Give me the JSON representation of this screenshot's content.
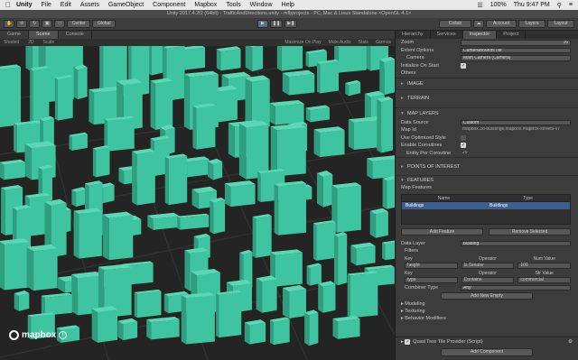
{
  "menubar": {
    "items": [
      "Unity",
      "File",
      "Edit",
      "Assets",
      "GameObject",
      "Component",
      "Mapbox",
      "Tools",
      "Window",
      "Help"
    ],
    "clock": "Thu 9:47 PM",
    "battery": "100%"
  },
  "window": {
    "title": "Unity 2017.4.2f2 (64bit) - TrafficAndDirections.unity - mfbprojects - PC, Mac & Linux Standalone <OpenGL 4.1>"
  },
  "toolbar": {
    "pivot": "Center",
    "space": "Global",
    "collab": "Collab",
    "account": "Account",
    "layers": "Layers",
    "layout": "Layout"
  },
  "scene": {
    "tabs": [
      "Game",
      "Scene",
      "Console"
    ],
    "shading": "Shaded",
    "mode": "2D",
    "scale_label": "Scale",
    "maximize": "Maximize On Play",
    "mute": "Mute Audio",
    "stats": "Stats",
    "gizmos": "Gizmos"
  },
  "logo": {
    "text": "mapbox",
    "info": "i"
  },
  "inspector": {
    "tabs": [
      "Hierarchy",
      "Services",
      "Inspector",
      "Project"
    ],
    "zoom_label": "Zoom",
    "zoom_value": "16",
    "extent_label": "Extent Options",
    "extent_value": "CameraBoundsTile",
    "camera_label": "Camera",
    "camera_value": "Main Camera (Camera)",
    "init_label": "Initialize On Start",
    "others": "Others",
    "image": "IMAGE",
    "terrain": "TERRAIN",
    "map_layers": "MAP LAYERS",
    "data_source_label": "Data Source",
    "data_source_value": "Custom",
    "map_id_label": "Map Id",
    "map_id_value": "mapbox.3d-buildings,mapbox.mapbox-streets-v7",
    "style_label": "Use Optimized Style",
    "coalesce_label": "Enable Coroutines",
    "entities_label": "Entity Per Coroutine",
    "entities_value": "25",
    "poi": "POINTS OF INTEREST",
    "features": "FEATURES",
    "map_features": "Map Features",
    "col_name": "Name",
    "col_type": "Type",
    "row_name": "Buildings",
    "row_type": "Buildings",
    "add_feature": "Add Feature",
    "remove_selected": "Remove Selected",
    "data_layer_label": "Data Layer",
    "data_layer_value": "building",
    "filters": "Filters",
    "key_label": "Key",
    "operator_label": "Operator",
    "num_value_label": "Num Value",
    "key1": "height",
    "op1": "Is Greater",
    "num1": "100",
    "key2": "type",
    "op2": "Contains",
    "str_value_label": "Str Value",
    "str1": "commercial",
    "combiner_label": "Combiner Type",
    "combiner_value": "Any",
    "add_empty": "Add New Empty",
    "modeling": "Modeling",
    "texturing": "Texturing",
    "behavior": "Behavior Modifiers",
    "provider": "Quad Tree Tile Provider (Script)",
    "add_component": "Add Component"
  },
  "colors": {
    "buildings": "#3ec49e",
    "ground": "#262626",
    "selection": "#3e5e8e"
  }
}
